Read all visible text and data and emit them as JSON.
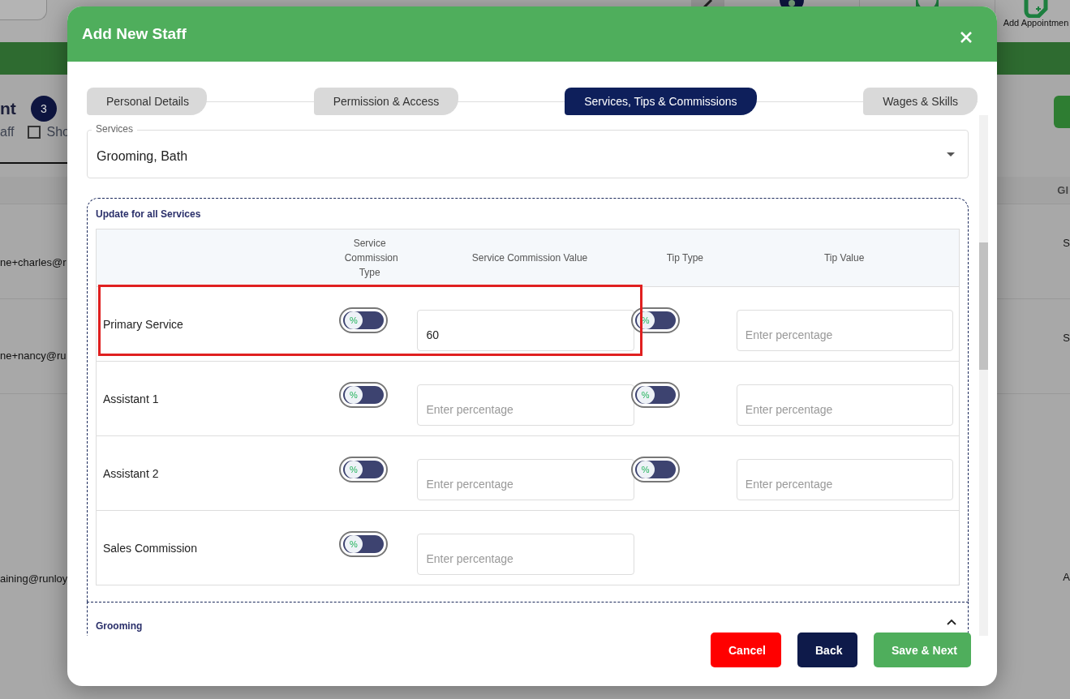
{
  "background": {
    "header_button": "Add Appointmen",
    "title_fragment": "nt",
    "count": "3",
    "staff_fragment": "aff",
    "show_checkbox": {
      "label": "Sho",
      "checked": false
    },
    "column_fragment": "Gl",
    "rows": [
      {
        "email": "ne+charles@r",
        "column_2": "S"
      },
      {
        "email": "ne+nancy@ru",
        "column_2": "S"
      },
      {
        "email": "aining@runloy",
        "column_2": "A"
      }
    ]
  },
  "dialog": {
    "title": "Add New Staff",
    "steps": [
      {
        "label": "Personal Details",
        "selected": false
      },
      {
        "label": "Permission & Access",
        "selected": false
      },
      {
        "label": "Services, Tips & Commissions",
        "selected": true
      },
      {
        "label": "Wages & Skills",
        "selected": false
      }
    ],
    "services": {
      "label": "Services",
      "value": "Grooming, Bath"
    },
    "update_all": {
      "title": "Update for all Services",
      "columns": [
        "Service Commission Type",
        "Service Commission Value",
        "Tip Type",
        "Tip Value"
      ],
      "rows": [
        {
          "name": "Primary Service",
          "highlighted": true,
          "commission_toggle": {
            "label": "%",
            "on": false
          },
          "commission_value": {
            "value": "60"
          },
          "tip_toggle": {
            "label": "%",
            "on": false
          },
          "tip_value": {
            "placeholder": "Enter percentage"
          }
        },
        {
          "name": "Assistant 1",
          "highlighted": false,
          "commission_toggle": {
            "label": "%",
            "on": false
          },
          "commission_value": {
            "placeholder": "Enter percentage"
          },
          "tip_toggle": {
            "label": "%",
            "on": false
          },
          "tip_value": {
            "placeholder": "Enter percentage"
          }
        },
        {
          "name": "Assistant 2",
          "highlighted": false,
          "commission_toggle": {
            "label": "%",
            "on": false
          },
          "commission_value": {
            "placeholder": "Enter percentage"
          },
          "tip_toggle": {
            "label": "%",
            "on": false
          },
          "tip_value": {
            "placeholder": "Enter percentage"
          }
        },
        {
          "name": "Sales Commission",
          "highlighted": false,
          "commission_toggle": {
            "label": "%",
            "on": false
          },
          "commission_value": {
            "placeholder": "Enter percentage"
          }
        }
      ]
    },
    "section": {
      "title": "Grooming",
      "expanded": true
    },
    "buttons": [
      {
        "label": "Cancel",
        "kind": "danger"
      },
      {
        "label": "Back",
        "kind": "secondary"
      },
      {
        "label": "Save & Next",
        "kind": "primary"
      }
    ]
  }
}
